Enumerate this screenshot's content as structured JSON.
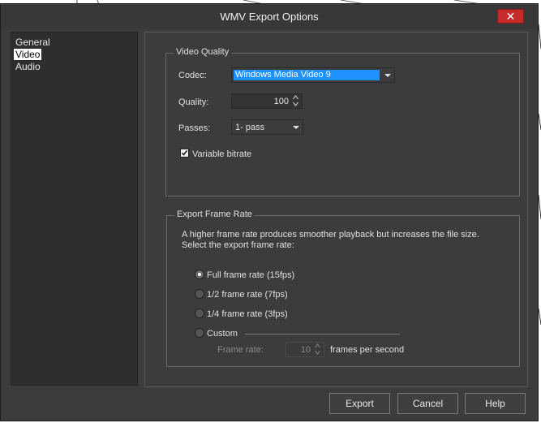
{
  "window": {
    "title": "WMV Export Options",
    "close_glyph": "✕"
  },
  "sidebar": {
    "items": [
      {
        "label": "General",
        "selected": false
      },
      {
        "label": "Video",
        "selected": true
      },
      {
        "label": "Audio",
        "selected": false
      }
    ]
  },
  "video_quality": {
    "legend": "Video Quality",
    "codec_label": "Codec:",
    "codec_value": "Windows Media Video 9",
    "quality_label": "Quality:",
    "quality_value": "100",
    "passes_label": "Passes:",
    "passes_value": "1- pass",
    "vbr_label": "Variable bitrate",
    "vbr_checked": true
  },
  "frame_rate": {
    "legend": "Export Frame Rate",
    "description_line1": "A higher frame rate produces smoother playback but increases the file size.",
    "description_line2": "Select the export frame rate:",
    "options": [
      {
        "label": "Full frame rate (15fps)",
        "selected": true
      },
      {
        "label": "1/2 frame rate (7fps)",
        "selected": false
      },
      {
        "label": "1/4 frame rate (3fps)",
        "selected": false
      },
      {
        "label": "Custom",
        "selected": false
      }
    ],
    "custom_rate_label": "Frame rate:",
    "custom_rate_value": "10",
    "custom_rate_unit": "frames per second"
  },
  "buttons": {
    "export": "Export",
    "cancel": "Cancel",
    "help": "Help"
  },
  "colors": {
    "dialog_bg": "#3c3c3c",
    "close_button": "#c42b2b",
    "selection": "#1e90ff"
  }
}
